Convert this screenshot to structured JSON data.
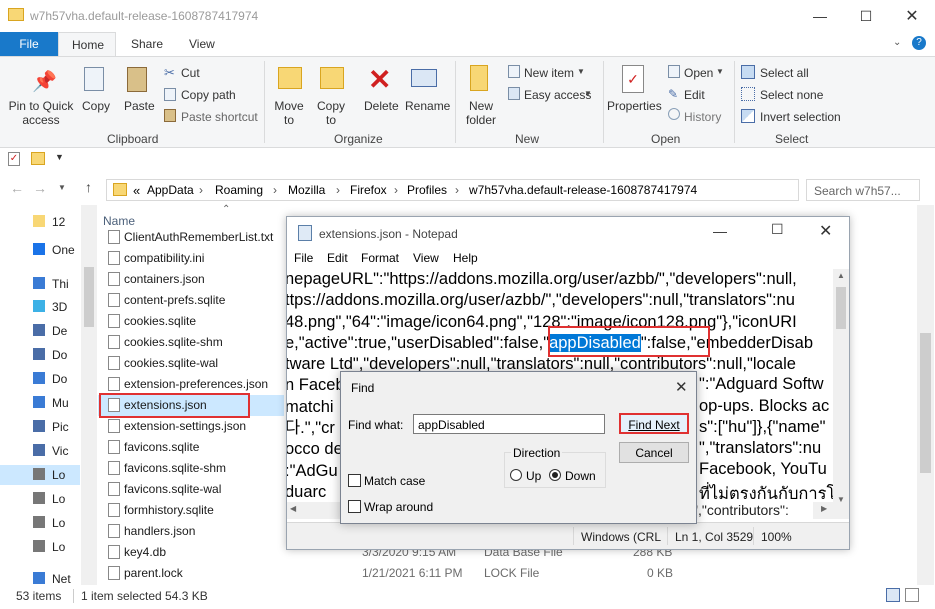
{
  "explorer": {
    "title": "w7h57vha.default-release-1608787417974",
    "tabs": [
      "File",
      "Home",
      "Share",
      "View"
    ],
    "ribbon": {
      "clipboard": {
        "pin": "Pin to Quick access",
        "copy": "Copy",
        "paste": "Paste",
        "cut": "Cut",
        "copy_path": "Copy path",
        "paste_shortcut": "Paste shortcut",
        "label": "Clipboard"
      },
      "organize": {
        "move_to": "Move to",
        "copy_to": "Copy to",
        "delete": "Delete",
        "rename": "Rename",
        "label": "Organize"
      },
      "new": {
        "new_folder": "New folder",
        "new_item": "New item",
        "easy_access": "Easy access",
        "label": "New"
      },
      "open": {
        "properties": "Properties",
        "open": "Open",
        "edit": "Edit",
        "history": "History",
        "label": "Open"
      },
      "select": {
        "select_all": "Select all",
        "select_none": "Select none",
        "invert": "Invert selection",
        "label": "Select"
      }
    },
    "breadcrumb": [
      "AppData",
      "Roaming",
      "Mozilla",
      "Firefox",
      "Profiles",
      "w7h57vha.default-release-1608787417974"
    ],
    "breadcrumb_prefix": "«",
    "search_placeholder": "Search w7h57...",
    "column_name": "Name",
    "nav_items": [
      "12",
      "One",
      "Thi",
      "3D",
      "De",
      "Do",
      "Do",
      "Mu",
      "Pic",
      "Vic",
      "Lo",
      "Lo",
      "Lo",
      "Lo",
      "Net"
    ],
    "files": [
      "ClientAuthRememberList.txt",
      "compatibility.ini",
      "containers.json",
      "content-prefs.sqlite",
      "cookies.sqlite",
      "cookies.sqlite-shm",
      "cookies.sqlite-wal",
      "extension-preferences.json",
      "extensions.json",
      "extension-settings.json",
      "favicons.sqlite",
      "favicons.sqlite-shm",
      "favicons.sqlite-wal",
      "formhistory.sqlite",
      "handlers.json",
      "key4.db",
      "parent.lock"
    ],
    "rows_detail": [
      {
        "date": "3/3/2020 9:15 AM",
        "type": "Data Base File",
        "size": "288 KB"
      },
      {
        "date": "1/21/2021 6:11 PM",
        "type": "LOCK File",
        "size": "0 KB"
      }
    ],
    "status_items": "53 items",
    "status_selected": "1 item selected  54.3 KB"
  },
  "notepad": {
    "title": "extensions.json - Notepad",
    "menu": [
      "File",
      "Edit",
      "Format",
      "View",
      "Help"
    ],
    "lines": [
      "nepageURL\":\"https://addons.mozilla.org/user/azbb/\",\"developers\":null,",
      "ttps://addons.mozilla.org/user/azbb/\",\"developers\":null,\"translators\":nu",
      "48.png\",\"64\":\"image/icon64.png\",\"128\":\"image/icon128.png\"},\"iconURI",
      "e,\"active\":true,\"userDisabled\":false,\"",
      "tware Ltd\",\"developers\":null,\"translators\":null,\"contributors\":null,\"locale",
      "n Faceb",
      "matchi",
      "다.\",\"cr",
      "occo de",
      ":\"AdGu",
      "duarc"
    ],
    "highlight": "appDisabled",
    "line4_after": "\":false,\"embedderDisab",
    "right_fragments": [
      "\":\"Adguard Softw",
      "op-ups. Blocks ac",
      "s\":[\"hu\"]},{\"name\"",
      "\",\"translators\":nu",
      "Facebook, YouTu",
      "ที่ไม่ตรงกันกับการโฆษ",
      "\",\"contributors\":"
    ],
    "status": {
      "encoding": "Windows (CRL",
      "position": "Ln 1, Col 3529",
      "zoom": "100%"
    }
  },
  "find": {
    "title": "Find",
    "find_what_label": "Find what:",
    "find_what_value": "appDisabled",
    "find_next": "Find Next",
    "cancel": "Cancel",
    "direction_label": "Direction",
    "up": "Up",
    "down": "Down",
    "match_case": "Match case",
    "wrap_around": "Wrap around"
  }
}
